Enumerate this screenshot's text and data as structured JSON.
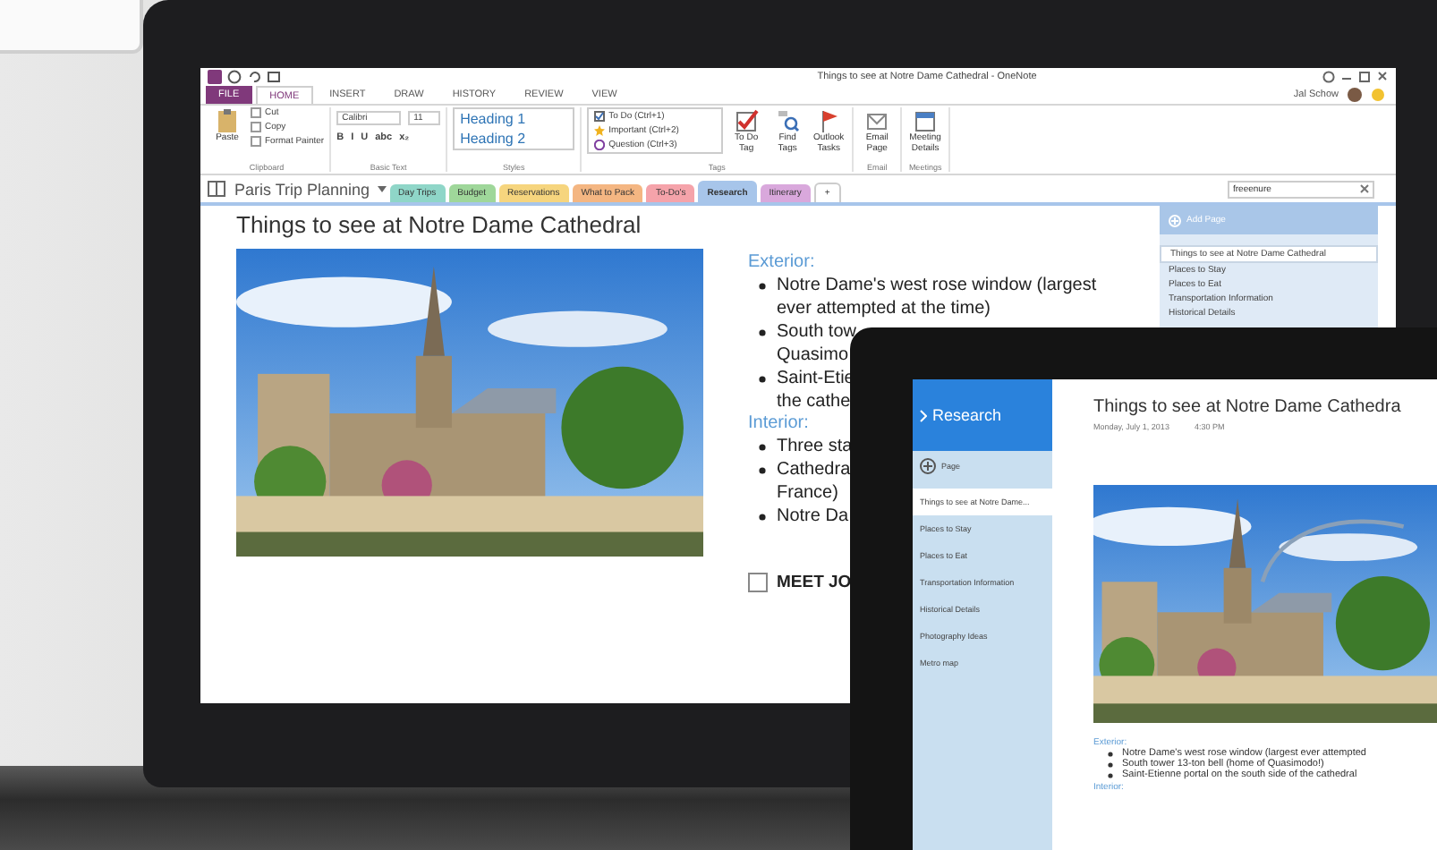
{
  "laptop": {
    "window_title": "Things to see at Notre Dame Cathedral - OneNote",
    "user_name": "Jal Schow",
    "ribbon_tabs": [
      {
        "label": "FILE",
        "kind": "file",
        "selected": false
      },
      {
        "label": "HOME",
        "kind": "tab",
        "selected": true
      },
      {
        "label": "INSERT",
        "kind": "tab",
        "selected": false
      },
      {
        "label": "DRAW",
        "kind": "tab",
        "selected": false
      },
      {
        "label": "HISTORY",
        "kind": "tab",
        "selected": false
      },
      {
        "label": "REVIEW",
        "kind": "tab",
        "selected": false
      },
      {
        "label": "VIEW",
        "kind": "tab",
        "selected": false
      }
    ],
    "ribbon_groups": [
      {
        "label": "Clipboard",
        "controls": [
          {
            "kind": "large",
            "label": "Paste"
          },
          {
            "kind": "small",
            "label": "Cut"
          },
          {
            "kind": "small",
            "label": "Copy"
          },
          {
            "kind": "small",
            "label": "Format Painter"
          }
        ]
      },
      {
        "label": "Basic Text",
        "controls": [
          {
            "kind": "combo",
            "label": "Calibri"
          },
          {
            "kind": "combo",
            "label": "11"
          },
          {
            "kind": "format",
            "label": "B"
          },
          {
            "kind": "format",
            "label": "I"
          },
          {
            "kind": "format",
            "label": "U"
          },
          {
            "kind": "format",
            "label": "abc"
          },
          {
            "kind": "format",
            "label": "x₂"
          }
        ]
      },
      {
        "label": "Styles",
        "controls": [
          {
            "kind": "style",
            "label": "Heading 1"
          },
          {
            "kind": "style",
            "label": "Heading 2"
          }
        ]
      },
      {
        "label": "Tags",
        "controls": [
          {
            "kind": "tag",
            "label": "To Do (Ctrl+1)"
          },
          {
            "kind": "tag",
            "label": "Important (Ctrl+2)"
          },
          {
            "kind": "tag",
            "label": "Question (Ctrl+3)"
          },
          {
            "kind": "large",
            "label": "To Do Tag"
          },
          {
            "kind": "large",
            "label": "Find Tags"
          },
          {
            "kind": "large",
            "label": "Outlook Tasks"
          }
        ]
      },
      {
        "label": "Email",
        "controls": [
          {
            "kind": "large",
            "label": "Email Page"
          }
        ]
      },
      {
        "label": "Meetings",
        "controls": [
          {
            "kind": "large",
            "label": "Meeting Details"
          }
        ]
      }
    ],
    "notebook": {
      "name": "Paris Trip Planning",
      "sections": [
        {
          "label": "Day Trips",
          "color": "#8fd6c8",
          "selected": false
        },
        {
          "label": "Budget",
          "color": "#9fd79a",
          "selected": false
        },
        {
          "label": "Reservations",
          "color": "#f6d57e",
          "selected": false
        },
        {
          "label": "What to Pack",
          "color": "#f4b682",
          "selected": false
        },
        {
          "label": "To-Do's",
          "color": "#f5a3aa",
          "selected": false
        },
        {
          "label": "Research",
          "color": "#a7c5ea",
          "selected": true
        },
        {
          "label": "Itinerary",
          "color": "#d9a8dc",
          "selected": false
        }
      ],
      "add_label": "+"
    },
    "search": {
      "value": "freeenure"
    },
    "page": {
      "title": "Things to see at Notre Dame Cathedral",
      "sections": [
        {
          "heading": "Exterior:",
          "bullets": [
            {
              "lines": [
                "Notre Dame's west rose window (largest",
                "ever attempted at the time)"
              ]
            },
            {
              "lines": [
                "South tow",
                "Quasimo"
              ]
            },
            {
              "lines": [
                "Saint-Etie",
                "the cathe"
              ]
            }
          ]
        },
        {
          "heading": "Interior:",
          "bullets": [
            {
              "lines": [
                "Three sta"
              ]
            },
            {
              "lines": [
                "Cathedra",
                "France)"
              ]
            },
            {
              "lines": [
                "Notre Da"
              ]
            }
          ]
        }
      ],
      "todo": {
        "label": "MEET JO",
        "checked": false
      }
    },
    "pages_pane": {
      "add_label": "Add Page",
      "items": [
        {
          "label": "Things to see at Notre Dame Cathedral",
          "selected": true
        },
        {
          "label": "Places to Stay",
          "selected": false
        },
        {
          "label": "Places to Eat",
          "selected": false
        },
        {
          "label": "Transportation Information",
          "selected": false
        },
        {
          "label": "Historical Details",
          "selected": false
        }
      ]
    }
  },
  "tablet": {
    "section_name": "Research",
    "add_label": "Page",
    "pages": [
      {
        "label": "Things to see at Notre Dame...",
        "selected": true
      },
      {
        "label": "Places to Stay",
        "selected": false
      },
      {
        "label": "Places to Eat",
        "selected": false
      },
      {
        "label": "Transportation Information",
        "selected": false
      },
      {
        "label": "Historical Details",
        "selected": false
      },
      {
        "label": "Photography Ideas",
        "selected": false
      },
      {
        "label": "Metro map",
        "selected": false
      }
    ],
    "page": {
      "title": "Things to see at Notre Dame Cathedra",
      "date": "Monday, July 1, 2013",
      "time": "4:30 PM",
      "heading": "Exterior:",
      "bullets": [
        "Notre Dame's west rose window (largest ever attempted",
        "South tower 13-ton bell (home of Quasimodo!)",
        "Saint-Etienne portal on the south side of the cathedral"
      ],
      "heading_2": "Interior:"
    }
  }
}
